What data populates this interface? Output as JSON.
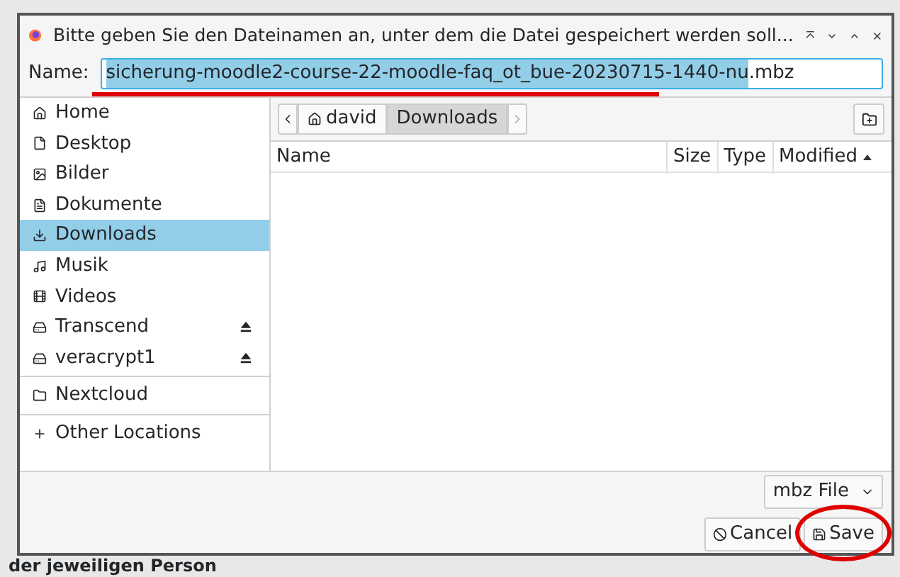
{
  "window": {
    "title": "Bitte geben Sie den Dateinamen an, unter dem die Datei gespeichert werden soll..."
  },
  "name_field": {
    "label": "Name:",
    "value_selected": "sicherung-moodle2-course-22-moodle-faq_ot_bue-20230715-1440-nu",
    "value_rest": ".mbz"
  },
  "sidebar": {
    "sections": [
      [
        {
          "label": "Home",
          "selected": false,
          "eject": false
        },
        {
          "label": "Desktop",
          "selected": false,
          "eject": false
        },
        {
          "label": "Bilder",
          "selected": false,
          "eject": false
        },
        {
          "label": "Dokumente",
          "selected": false,
          "eject": false
        },
        {
          "label": "Downloads",
          "selected": true,
          "eject": false
        },
        {
          "label": "Musik",
          "selected": false,
          "eject": false
        },
        {
          "label": "Videos",
          "selected": false,
          "eject": false
        },
        {
          "label": "Transcend",
          "selected": false,
          "eject": true
        },
        {
          "label": "veracrypt1",
          "selected": false,
          "eject": true
        }
      ],
      [
        {
          "label": "Nextcloud",
          "selected": false,
          "eject": false
        }
      ],
      [
        {
          "label": "Other Locations",
          "selected": false,
          "eject": false
        }
      ]
    ]
  },
  "path_bar": {
    "segments": [
      {
        "label": "david",
        "selected": false,
        "home": true
      },
      {
        "label": "Downloads",
        "selected": true,
        "home": false
      }
    ]
  },
  "table": {
    "columns": [
      {
        "label": "Name",
        "sorted": false
      },
      {
        "label": "Size",
        "sorted": false
      },
      {
        "label": "Type",
        "sorted": false
      },
      {
        "label": "Modified",
        "sorted": true
      }
    ]
  },
  "filter": {
    "value": "mbz File"
  },
  "buttons": [
    {
      "label": "Cancel",
      "kind": "cancel"
    },
    {
      "label": "Save",
      "kind": "save"
    }
  ],
  "background_text": "der jeweiligen Person"
}
